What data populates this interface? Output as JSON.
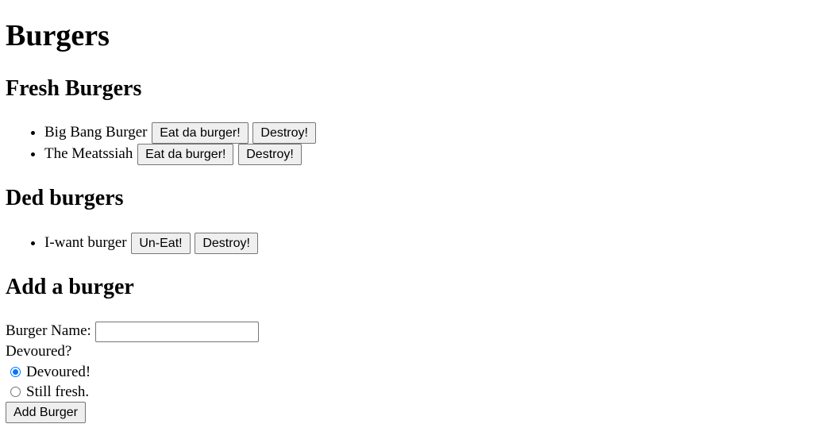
{
  "title": "Burgers",
  "fresh": {
    "heading": "Fresh Burgers",
    "items": [
      {
        "name": "Big Bang Burger",
        "action_label": "Eat da burger!",
        "destroy_label": "Destroy!"
      },
      {
        "name": "The Meatssiah",
        "action_label": "Eat da burger!",
        "destroy_label": "Destroy!"
      }
    ]
  },
  "ded": {
    "heading": "Ded burgers",
    "items": [
      {
        "name": "I-want burger",
        "action_label": "Un-Eat!",
        "destroy_label": "Destroy!"
      }
    ]
  },
  "add": {
    "heading": "Add a burger",
    "name_label": "Burger Name:",
    "name_value": "",
    "devoured_label": "Devoured?",
    "options": [
      {
        "label": "Devoured!",
        "checked": true
      },
      {
        "label": "Still fresh.",
        "checked": false
      }
    ],
    "submit_label": "Add Burger"
  },
  "colors": {
    "radio_accent": "#0075ff",
    "button_bg": "#efefef",
    "button_border": "#767676"
  }
}
